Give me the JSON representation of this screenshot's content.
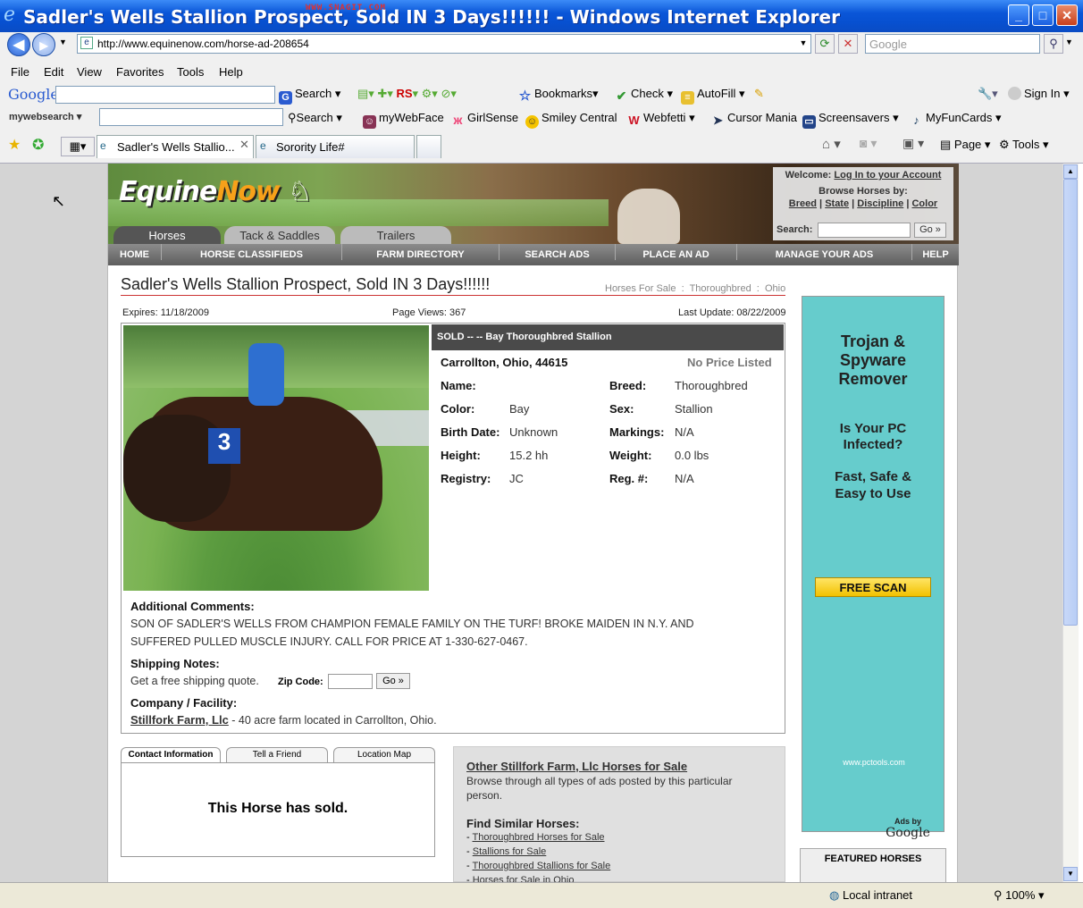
{
  "window": {
    "title": "Sadler's Wells Stallion Prospect, Sold IN 3 Days!!!!!! - Windows Internet Explorer",
    "watermark": "WWW.SNAGIT.COM",
    "minimize": "_",
    "maximize": "□",
    "close": "✕"
  },
  "address_bar": {
    "back": "◀",
    "forward": "▶",
    "url": "http://www.equinenow.com/horse-ad-208654",
    "search_placeholder": "Google",
    "go": "⟳",
    "stop": "✕"
  },
  "menu": [
    "File",
    "Edit",
    "View",
    "Favorites",
    "Tools",
    "Help"
  ],
  "google_toolbar": {
    "logo": "Google",
    "search": "Search",
    "check": "Check",
    "autofill": "AutoFill",
    "bookmarks": "Bookmarks",
    "sign_in": "Sign In"
  },
  "mywebsearch": {
    "logo": "mywebsearch",
    "search": "Search",
    "items": [
      "myWebFace",
      "GirlSense",
      "Smiley Central",
      "Webfetti",
      "Cursor Mania",
      "Screensavers",
      "MyFunCards"
    ]
  },
  "tabs": {
    "active": "Sadler's Wells Stallio...",
    "other": "Sorority Life#",
    "page": "Page",
    "tools": "Tools"
  },
  "site": {
    "logo_part1": "Equine",
    "logo_part2": "Now",
    "welcome": "Welcome:",
    "login": "Log In to your Account",
    "browse": "Browse Horses by:",
    "browse_links": [
      "Breed",
      "State",
      "Discipline",
      "Color"
    ],
    "search_label": "Search:",
    "go": "Go »",
    "header_tabs": [
      "Horses",
      "Tack & Saddles",
      "Trailers"
    ],
    "nav": [
      "HOME",
      "HORSE CLASSIFIEDS",
      "FARM DIRECTORY",
      "SEARCH ADS",
      "PLACE AN AD",
      "MANAGE YOUR ADS",
      "HELP"
    ]
  },
  "ad_listing": {
    "title": "Sadler's Wells Stallion Prospect, Sold IN 3 Days!!!!!!",
    "breadcrumb": [
      "Horses For Sale",
      "Thoroughbred",
      "Ohio"
    ],
    "expires": "Expires: 11/18/2009",
    "page_views": "Page Views: 367",
    "last_update": "Last Update: 08/22/2009",
    "sold_bar": "SOLD -- -- Bay Thoroughbred Stallion",
    "location": "Carrollton, Ohio, 44615",
    "price": "No Price Listed",
    "fields": {
      "name_label": "Name:",
      "name_value": "",
      "breed_label": "Breed:",
      "breed_value": "Thoroughbred",
      "color_label": "Color:",
      "color_value": "Bay",
      "sex_label": "Sex:",
      "sex_value": "Stallion",
      "birth_label": "Birth Date:",
      "birth_value": "Unknown",
      "markings_label": "Markings:",
      "markings_value": "N/A",
      "height_label": "Height:",
      "height_value": "15.2 hh",
      "weight_label": "Weight:",
      "weight_value": "0.0 lbs",
      "registry_label": "Registry:",
      "registry_value": "JC",
      "reg_label": "Reg. #:",
      "reg_value": "N/A"
    },
    "comments_label": "Additional Comments:",
    "comments_line1": "SON OF SADLER'S WELLS FROM CHAMPION FEMALE FAMILY ON THE TURF! BROKE MAIDEN IN N.Y. AND",
    "comments_line2": "SUFFERED PULLED MUSCLE INJURY. CALL FOR PRICE AT 1-330-627-0467.",
    "shipping_label": "Shipping Notes:",
    "shipping_text": "Get a free shipping quote.",
    "zip_label": "Zip Code:",
    "zip_go": "Go »",
    "company_label": "Company / Facility:",
    "company_name": "Stillfork Farm, Llc",
    "company_desc": " - 40 acre farm located in Carrollton, Ohio."
  },
  "contact": {
    "tabs": [
      "Contact Information",
      "Tell a Friend",
      "Location Map"
    ],
    "sold_message": "This Horse has sold."
  },
  "other_horses": {
    "title": "Other Stillfork Farm, Llc Horses for Sale",
    "desc_line1": "Browse through all types of ads posted by this particular",
    "desc_line2": "person.",
    "similar_label": "Find Similar Horses:",
    "links": [
      "Thoroughbred Horses for Sale",
      "Stallions for Sale",
      "Thoroughbred Stallions for Sale",
      "Horses for Sale in Ohio"
    ]
  },
  "side_ad": {
    "title_line1": "Trojan &",
    "title_line2": "Spyware",
    "title_line3": "Remover",
    "q_line1": "Is Your PC",
    "q_line2": "Infected?",
    "f_line1": "Fast, Safe &",
    "f_line2": "Easy to Use",
    "button": "FREE SCAN",
    "url": "www.pctools.com",
    "ads_by": "Ads by",
    "ads_brand": "Google"
  },
  "featured": {
    "title": "FEATURED HORSES"
  },
  "status": {
    "zone": "Local intranet",
    "zoom": "100%"
  }
}
